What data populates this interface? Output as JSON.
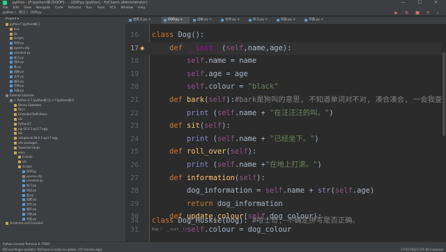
{
  "window": {
    "title": "python - [F:\\python\\练习\\OOP] - ...\\OOP.py [python] - PyCharm (Administrator)",
    "controls": "— ☐ ✕"
  },
  "menu": [
    "File",
    "Edit",
    "View",
    "Navigate",
    "Code",
    "Refactor",
    "Run",
    "Tools",
    "VCS",
    "Window",
    "Help"
  ],
  "navbar": {
    "path": "python  〉  练习  〉  OOP.py",
    "right_icons": "▶ ⚙ ■ ⟳ ⌕"
  },
  "project_panel": {
    "title": "Project ▾",
    "tree": [
      {
        "label": "python   F:\\python\\练习",
        "depth": 0,
        "icon": "folder"
      },
      {
        "label": "kivy",
        "depth": 1,
        "icon": "folder"
      },
      {
        "label": "lib",
        "depth": 1,
        "icon": "folder"
      },
      {
        "label": "Scripts",
        "depth": 1,
        "icon": "folder"
      },
      {
        "label": "OOP.py",
        "depth": 1,
        "icon": "py"
      },
      {
        "label": "pyvenv.cfg",
        "depth": 1,
        "icon": "file"
      },
      {
        "label": "venvtest.py",
        "depth": 1,
        "icon": "py"
      },
      {
        "label": "练习.py",
        "depth": 1,
        "icon": "py"
      },
      {
        "label": "测试.py",
        "depth": 1,
        "icon": "py"
      },
      {
        "label": "类.py",
        "depth": 1,
        "icon": "py"
      },
      {
        "label": "函数.py",
        "depth": 1,
        "icon": "py"
      },
      {
        "label": "文件.py",
        "depth": 1,
        "icon": "py"
      },
      {
        "label": "循环.py",
        "depth": 1,
        "icon": "py"
      },
      {
        "label": "字典.py",
        "depth": 1,
        "icon": "py"
      },
      {
        "label": "列表.py",
        "depth": 1,
        "icon": "py"
      },
      {
        "label": "External Libraries",
        "depth": 0,
        "icon": "lib"
      },
      {
        "label": "< Python 3.7 (python练习) > F:\\python\\练习",
        "depth": 1,
        "icon": "lib"
      },
      {
        "label": "Binary Skeletons",
        "depth": 2,
        "icon": "folder"
      },
      {
        "label": "DLLs",
        "depth": 2,
        "icon": "folder"
      },
      {
        "label": "Extended Definitions",
        "depth": 2,
        "icon": "folder"
      },
      {
        "label": "Lib",
        "depth": 2,
        "icon": "folder"
      },
      {
        "label": "Python37",
        "depth": 2,
        "icon": "folder"
      },
      {
        "label": "pip-10.0.1-py3.7.egg",
        "depth": 2,
        "icon": "folder"
      },
      {
        "label": "Lib",
        "depth": 2,
        "icon": "folder"
      },
      {
        "label": "setuptools-39.0.1-py3.7.egg",
        "depth": 2,
        "icon": "folder"
      },
      {
        "label": "site-packages",
        "depth": 2,
        "icon": "folder"
      },
      {
        "label": "Typeshed Stubs",
        "depth": 2,
        "icon": "folder"
      },
      {
        "label": "venv",
        "depth": 2,
        "icon": "folder"
      },
      {
        "label": "Include",
        "depth": 3,
        "icon": "folder"
      },
      {
        "label": "Lib",
        "depth": 3,
        "icon": "folder"
      },
      {
        "label": "Scripts",
        "depth": 3,
        "icon": "folder"
      },
      {
        "label": "OOP.py",
        "depth": 4,
        "icon": "py"
      },
      {
        "label": "pyvenv.cfg",
        "depth": 4,
        "icon": "file"
      },
      {
        "label": "venvtest.py",
        "depth": 4,
        "icon": "py"
      },
      {
        "label": "练习.py",
        "depth": 4,
        "icon": "py"
      },
      {
        "label": "测试.py",
        "depth": 4,
        "icon": "py"
      },
      {
        "label": "类.py",
        "depth": 4,
        "icon": "py"
      },
      {
        "label": "函数.py",
        "depth": 4,
        "icon": "py"
      },
      {
        "label": "文件.py",
        "depth": 4,
        "icon": "py"
      },
      {
        "label": "循环.py",
        "depth": 4,
        "icon": "py"
      },
      {
        "label": "字典.py",
        "depth": 4,
        "icon": "py"
      },
      {
        "label": "列表.py",
        "depth": 4,
        "icon": "py"
      },
      {
        "label": "Scratches and Consoles",
        "depth": 0,
        "icon": "folder"
      }
    ]
  },
  "tabs": [
    {
      "label": "类练习.py ×",
      "active": false
    },
    {
      "label": "OOP.py ×",
      "active": true
    },
    {
      "label": "函数.py ×",
      "active": false
    },
    {
      "label": "文件.py ×",
      "active": false
    },
    {
      "label": "练习.py ×",
      "active": false
    },
    {
      "label": "列表.py ×",
      "active": false
    },
    {
      "label": "字典.py ×",
      "active": false
    }
  ],
  "code": {
    "current_line": 17,
    "lines": [
      {
        "n": 16,
        "marker": "",
        "tokens": [
          {
            "t": "class ",
            "c": "#cc7832"
          },
          {
            "t": "Dog",
            "c": "#a9b7c6"
          },
          {
            "t": "():",
            "c": "#a9b7c6"
          }
        ]
      },
      {
        "n": 17,
        "marker": "◉",
        "tokens": [
          {
            "t": "    def ",
            "c": "#cc7832"
          },
          {
            "t": "__init__",
            "c": "#b200b2"
          },
          {
            "t": "(",
            "c": "#a9b7c6"
          },
          {
            "t": "self",
            "c": "#94558d"
          },
          {
            "t": ",name,",
            "c": "#a9b7c6"
          },
          {
            "t": "age",
            "c": "#a9b7c6"
          },
          {
            "t": "):",
            "c": "#a9b7c6"
          }
        ]
      },
      {
        "n": 18,
        "marker": "",
        "tokens": [
          {
            "t": "        self",
            "c": "#94558d"
          },
          {
            "t": ".name = name",
            "c": "#a9b7c6"
          }
        ]
      },
      {
        "n": 19,
        "marker": "",
        "tokens": [
          {
            "t": "        self",
            "c": "#94558d"
          },
          {
            "t": ".age = age",
            "c": "#a9b7c6"
          }
        ]
      },
      {
        "n": 20,
        "marker": "",
        "tokens": [
          {
            "t": "        self",
            "c": "#94558d"
          },
          {
            "t": ".colour = ",
            "c": "#a9b7c6"
          },
          {
            "t": "\"black\"",
            "c": "#6a8759"
          }
        ]
      },
      {
        "n": 21,
        "marker": "",
        "tokens": [
          {
            "t": "    def ",
            "c": "#cc7832"
          },
          {
            "t": "bark",
            "c": "#ffc66d"
          },
          {
            "t": "(",
            "c": "#a9b7c6"
          },
          {
            "t": "self",
            "c": "#94558d"
          },
          {
            "t": "):",
            "c": "#a9b7c6"
          },
          {
            "t": "#bark是狗叫的意思, 不知道单词对不对, 凑合凑合, 一会我查一下",
            "c": "#808080"
          }
        ]
      },
      {
        "n": 22,
        "marker": "",
        "tokens": [
          {
            "t": "        print ",
            "c": "#8888c6"
          },
          {
            "t": "(",
            "c": "#a9b7c6"
          },
          {
            "t": "self",
            "c": "#94558d"
          },
          {
            "t": ".name + ",
            "c": "#a9b7c6"
          },
          {
            "t": "\"在汪汪汪的叫。\"",
            "c": "#6a8759"
          },
          {
            "t": ")",
            "c": "#a9b7c6"
          }
        ]
      },
      {
        "n": 23,
        "marker": "",
        "tokens": [
          {
            "t": "    def ",
            "c": "#cc7832"
          },
          {
            "t": "sit",
            "c": "#ffc66d"
          },
          {
            "t": "(",
            "c": "#a9b7c6"
          },
          {
            "t": "self",
            "c": "#94558d"
          },
          {
            "t": "):",
            "c": "#a9b7c6"
          }
        ]
      },
      {
        "n": 24,
        "marker": "",
        "tokens": [
          {
            "t": "        print ",
            "c": "#8888c6"
          },
          {
            "t": "(",
            "c": "#a9b7c6"
          },
          {
            "t": "self",
            "c": "#94558d"
          },
          {
            "t": ".name + ",
            "c": "#a9b7c6"
          },
          {
            "t": "\"已经坐下。\"",
            "c": "#6a8759"
          },
          {
            "t": ")",
            "c": "#a9b7c6"
          }
        ]
      },
      {
        "n": 25,
        "marker": "",
        "tokens": [
          {
            "t": "    def ",
            "c": "#cc7832"
          },
          {
            "t": "roll_over",
            "c": "#ffc66d"
          },
          {
            "t": "(",
            "c": "#a9b7c6"
          },
          {
            "t": "self",
            "c": "#94558d"
          },
          {
            "t": "):",
            "c": "#a9b7c6"
          }
        ]
      },
      {
        "n": 26,
        "marker": "",
        "tokens": [
          {
            "t": "        print ",
            "c": "#8888c6"
          },
          {
            "t": "(",
            "c": "#a9b7c6"
          },
          {
            "t": "self",
            "c": "#94558d"
          },
          {
            "t": ".name +",
            "c": "#a9b7c6"
          },
          {
            "t": "\"在地上打滚。\"",
            "c": "#6a8759"
          },
          {
            "t": ")",
            "c": "#a9b7c6"
          }
        ]
      },
      {
        "n": 27,
        "marker": "",
        "tokens": [
          {
            "t": "    def ",
            "c": "#cc7832"
          },
          {
            "t": "information",
            "c": "#ffc66d"
          },
          {
            "t": "(",
            "c": "#a9b7c6"
          },
          {
            "t": "self",
            "c": "#94558d"
          },
          {
            "t": "):",
            "c": "#a9b7c6"
          }
        ]
      },
      {
        "n": 28,
        "marker": "",
        "tokens": [
          {
            "t": "        dog_information = ",
            "c": "#a9b7c6"
          },
          {
            "t": "self",
            "c": "#94558d"
          },
          {
            "t": ".name + ",
            "c": "#a9b7c6"
          },
          {
            "t": "str",
            "c": "#8888c6"
          },
          {
            "t": "(",
            "c": "#a9b7c6"
          },
          {
            "t": "self",
            "c": "#94558d"
          },
          {
            "t": ".age)",
            "c": "#a9b7c6"
          }
        ]
      },
      {
        "n": 29,
        "marker": "",
        "tokens": [
          {
            "t": "        return ",
            "c": "#cc7832"
          },
          {
            "t": "dog_information",
            "c": "#a9b7c6"
          }
        ]
      },
      {
        "n": 30,
        "marker": "",
        "tokens": [
          {
            "t": "    def ",
            "c": "#cc7832"
          },
          {
            "t": "update_colour",
            "c": "#ffc66d"
          },
          {
            "t": "(",
            "c": "#a9b7c6"
          },
          {
            "t": "self",
            "c": "#94558d"
          },
          {
            "t": ",dog_colour):",
            "c": "#a9b7c6"
          }
        ]
      },
      {
        "n": 31,
        "marker": "",
        "tokens": [
          {
            "t": "        self",
            "c": "#94558d"
          },
          {
            "t": ".colour = dog_colour",
            "c": "#a9b7c6"
          }
        ]
      },
      {
        "n": 32,
        "marker": "",
        "tokens": []
      },
      {
        "n": 33,
        "marker": "",
        "tokens": []
      },
      {
        "n": 34,
        "marker": "",
        "tokens": [
          {
            "t": "class ",
            "c": "#cc7832"
          },
          {
            "t": "Dog_Huskie",
            "c": "#a9b7c6"
          },
          {
            "t": "(Dog): ",
            "c": "#a9b7c6"
          },
          {
            "t": "#哈士奇, 不确定拼写是否正确。",
            "c": "#808080"
          }
        ]
      }
    ],
    "breadcrumb": "Dog  〉 __init__()"
  },
  "statusbar": {
    "bottom_tabs": "Python Console    Terminal    6: TODO",
    "message": "IDE and Plugin Updates: PyCharm is ready to update. (23 minutes ago)",
    "right": "17:43   CRLF‡   UTF-8‡   4 spaces‡"
  },
  "colors": {
    "editor_bg": "#2b2b2b",
    "panel_bg": "#3c3f41",
    "keyword": "#cc7832",
    "string": "#6a8759",
    "comment": "#808080",
    "self": "#94558d",
    "function": "#ffc66d"
  }
}
